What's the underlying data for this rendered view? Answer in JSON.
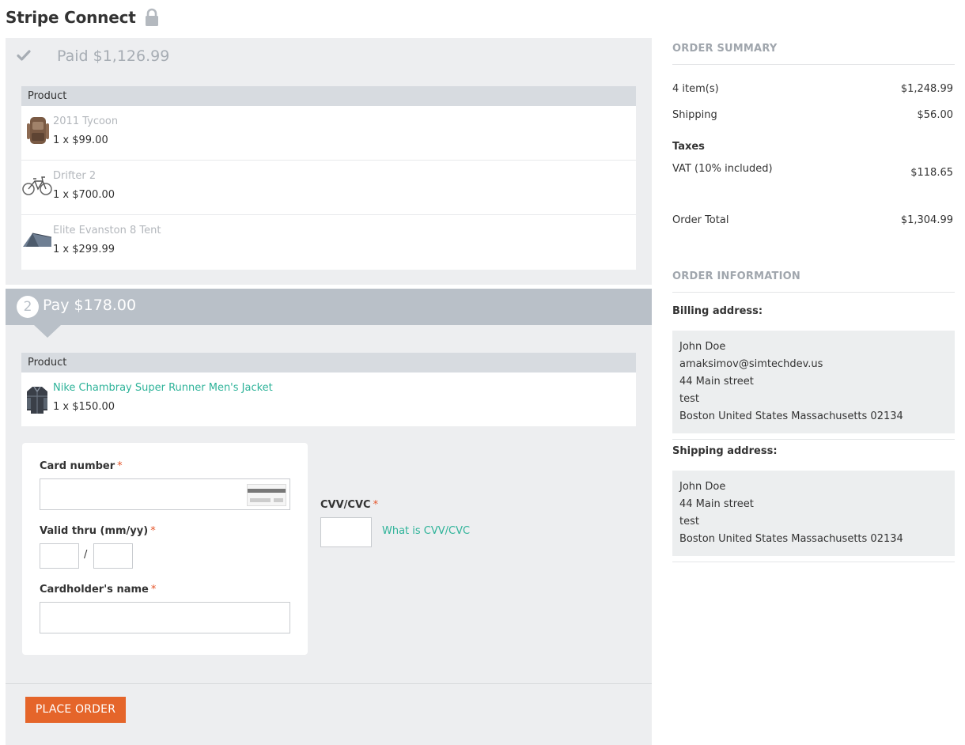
{
  "header": {
    "title": "Stripe Connect"
  },
  "step1": {
    "paid_label": "Paid $1,126.99",
    "table_header": "Product",
    "products": [
      {
        "name": "2011 Tycoon",
        "qty": "1 x $99.00",
        "icon": "backpack-image"
      },
      {
        "name": "Drifter 2",
        "qty": "1 x $700.00",
        "icon": "bicycle-image"
      },
      {
        "name": "Elite Evanston 8 Tent",
        "qty": "1 x $299.99",
        "icon": "tent-image"
      }
    ]
  },
  "step2": {
    "number": "2",
    "pay_label": "Pay $178.00",
    "table_header": "Product",
    "products": [
      {
        "name": "Nike Chambray Super Runner Men's Jacket",
        "qty": "1 x $150.00",
        "icon": "jacket-image"
      }
    ]
  },
  "payment_form": {
    "card_number_label": "Card number",
    "valid_thru_label": "Valid thru (mm/yy)",
    "cardholder_label": "Cardholder's name",
    "cvv_label": "CVV/CVC",
    "cvv_help_link": "What is CVV/CVC",
    "required_mark": "*",
    "slash": "/",
    "card_number_value": "",
    "month_value": "",
    "year_value": "",
    "cardholder_value": "",
    "cvv_value": ""
  },
  "actions": {
    "place_order": "PLACE ORDER"
  },
  "order_summary": {
    "title": "ORDER SUMMARY",
    "items_label": "4 item(s)",
    "items_value": "$1,248.99",
    "shipping_label": "Shipping",
    "shipping_value": "$56.00",
    "taxes_label": "Taxes",
    "vat_label": "VAT (10% included)",
    "vat_value": "$118.65",
    "total_label": "Order Total",
    "total_value": "$1,304.99"
  },
  "order_information": {
    "title": "ORDER INFORMATION",
    "billing_label": "Billing address:",
    "billing": {
      "name": "John Doe",
      "email": "amaksimov@simtechdev.us",
      "street": "44 Main street",
      "line2": "test",
      "city_line": "Boston United States Massachusetts 02134"
    },
    "shipping_label": "Shipping address:",
    "shipping": {
      "name": "John Doe",
      "street": "44 Main street",
      "line2": "test",
      "city_line": "Boston United States Massachusetts 02134"
    }
  },
  "colors": {
    "accent_orange": "#e5652a",
    "link_green": "#2eb399",
    "step_header_gray": "#b9c0c8",
    "panel_bg": "#edeef0"
  }
}
